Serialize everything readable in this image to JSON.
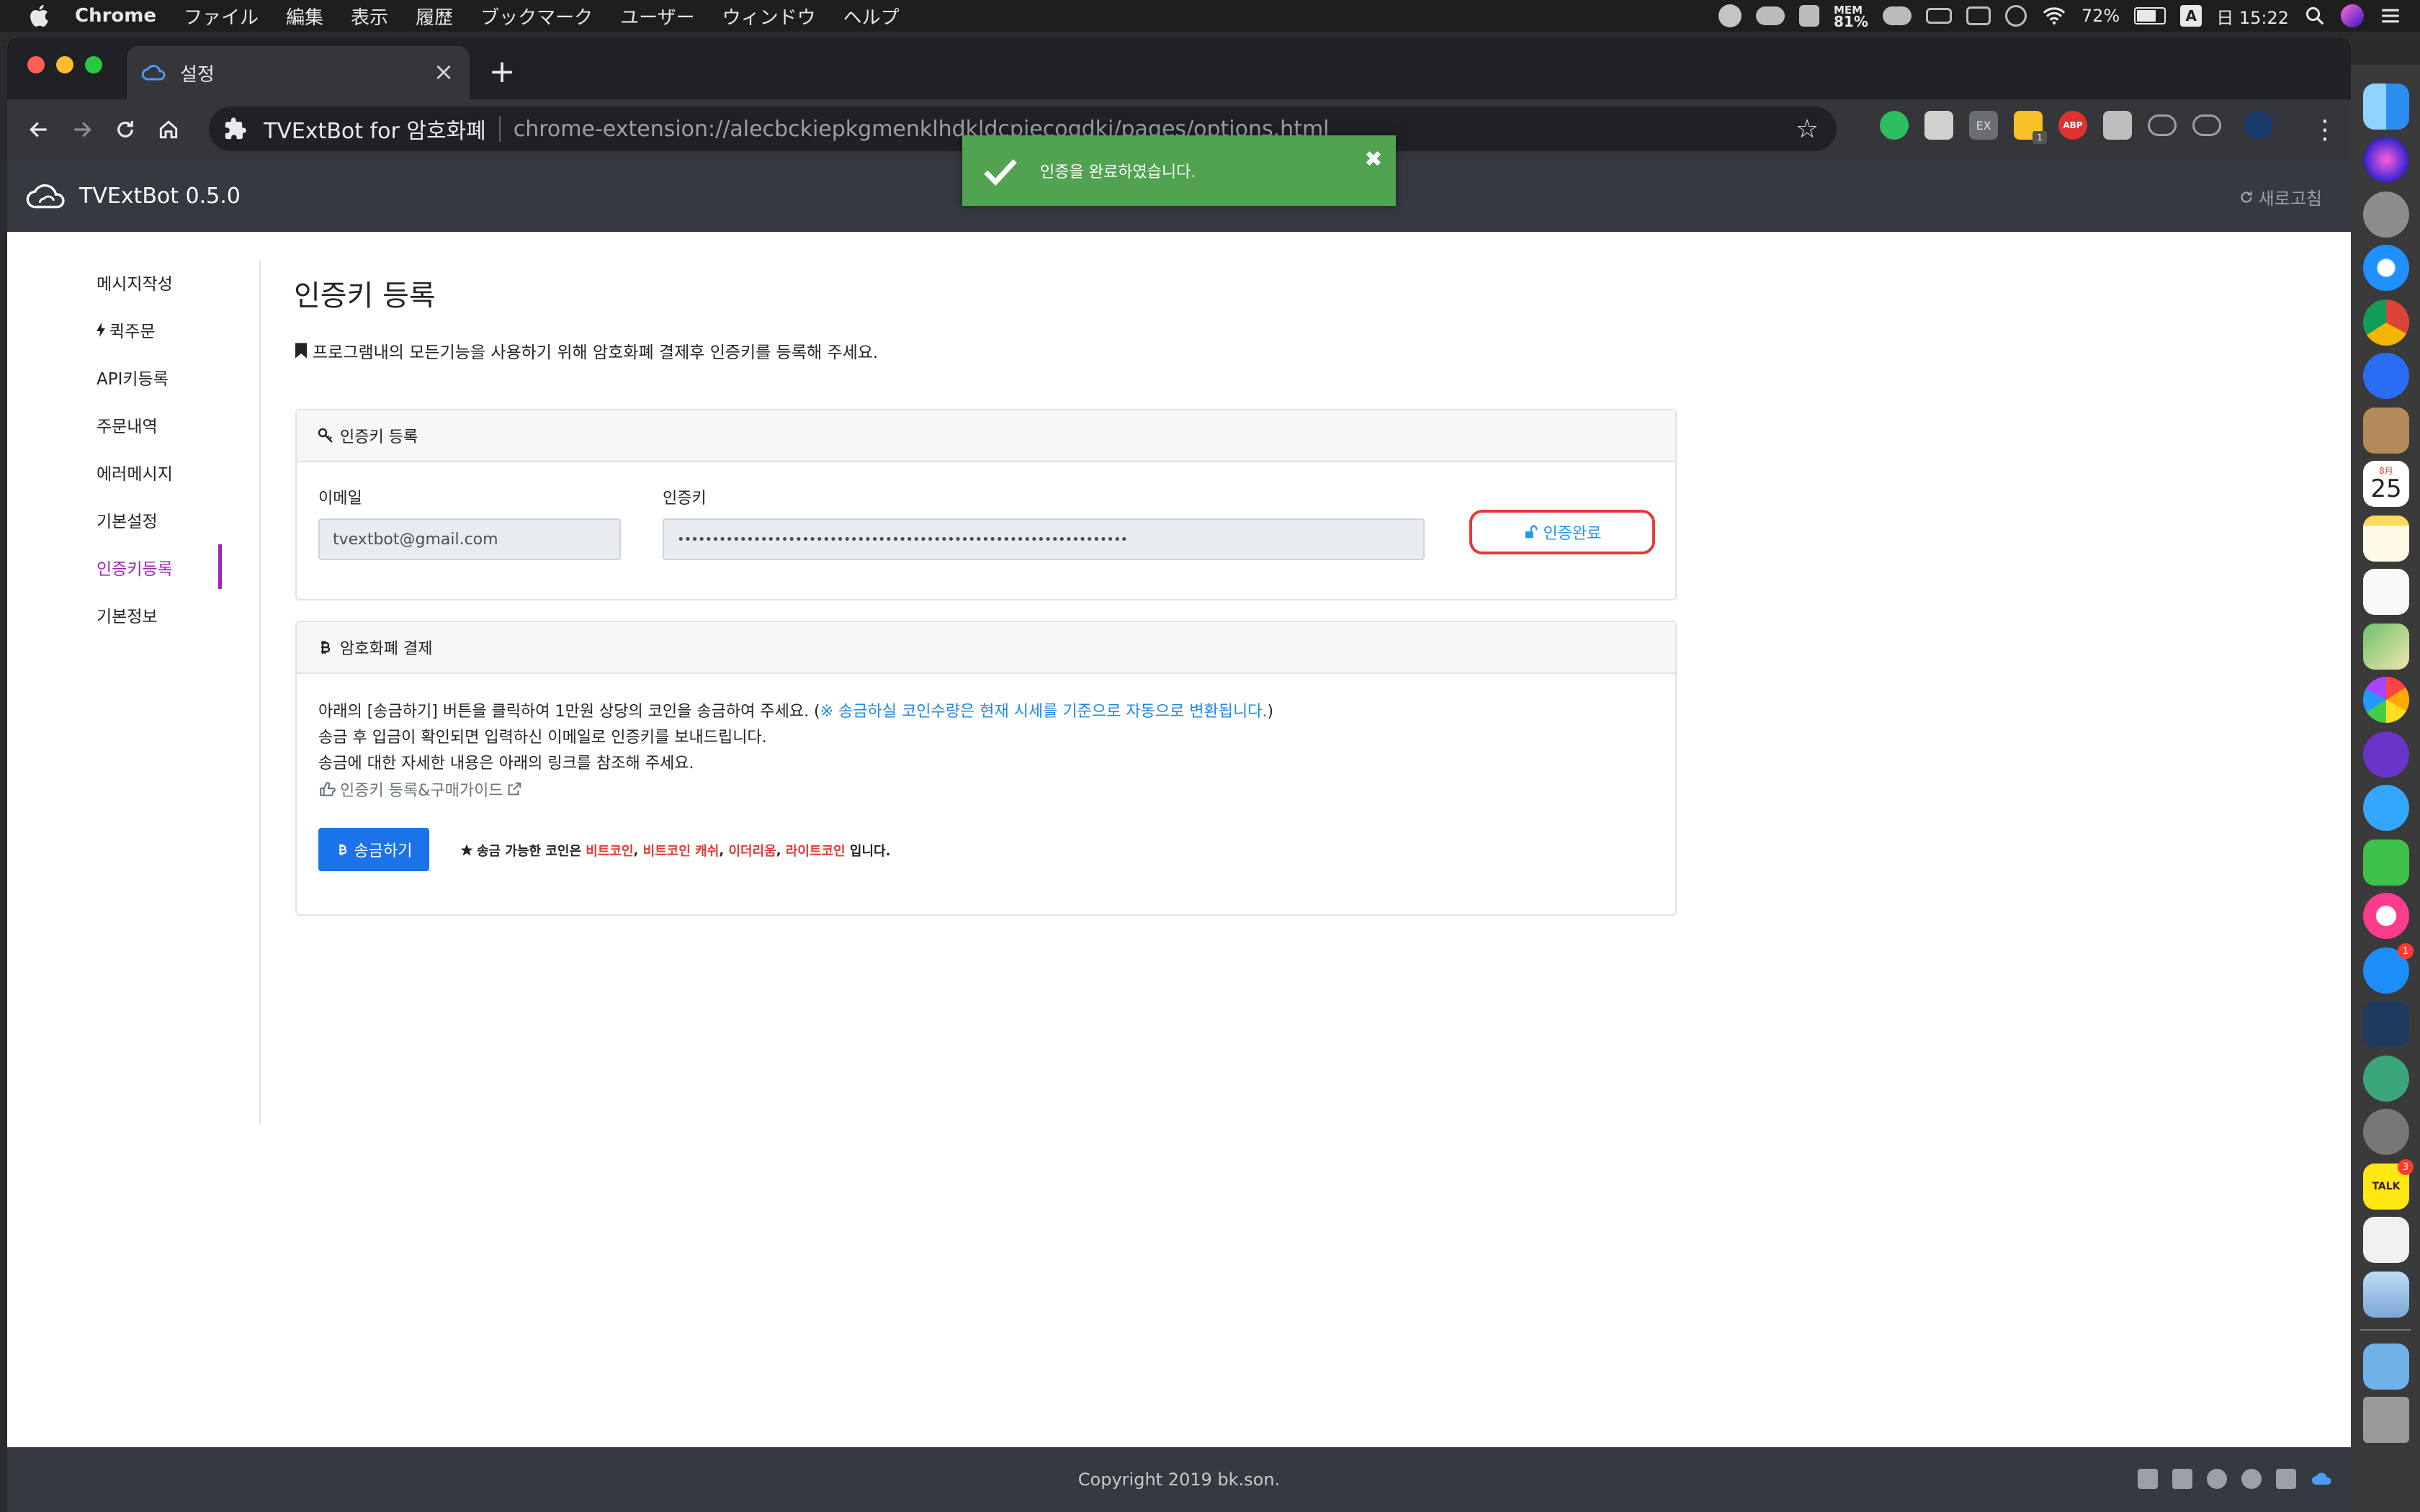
{
  "menubar": {
    "app_name": "Chrome",
    "menus": [
      "ファイル",
      "編集",
      "表示",
      "履歴",
      "ブックマーク",
      "ユーザー",
      "ウィンドウ",
      "ヘルプ"
    ],
    "mem_label": "MEM",
    "mem_value": "81%",
    "battery": "72%",
    "input_source": "A",
    "clock": "日 15:22"
  },
  "browser": {
    "tab_title": "설정",
    "site_name": "TVExtBot for 암호화폐",
    "url": "chrome-extension://alecbckiepkgmenklhdkldcpjecogdkj/pages/options.html",
    "ext_badge": "1"
  },
  "dock": {
    "calendar_day": "25",
    "calendar_month": "8月",
    "kakao_label": "TALK",
    "kakao_badge": "3",
    "appstore_badge": "1"
  },
  "app": {
    "brand": "TVExtBot 0.5.0",
    "refresh_label": "새로고침"
  },
  "toast": {
    "message": "인증을 완료하였습니다."
  },
  "sidebar": {
    "items": [
      "메시지작성",
      "퀵주문",
      "API키등록",
      "주문내역",
      "에러메시지",
      "기본설정",
      "인증키등록",
      "기본정보"
    ],
    "active_index": 6
  },
  "main": {
    "title": "인증키 등록",
    "notice": "프로그램내의 모든기능을 사용하기 위해 암호화폐 결제후 인증키를 등록해 주세요."
  },
  "auth_card": {
    "header": "인증키 등록",
    "email_label": "이메일",
    "email_value": "tvextbot@gmail.com",
    "key_label": "인증키",
    "key_value": "•••••••••••••••••••••••••••••••••••••••••••••••••••••••••••••••••",
    "button_label": "인증완료"
  },
  "pay_card": {
    "header": "암호화폐 결제",
    "line1_a": "아래의 [송금하기] 버튼을 클릭하여 1만원 상당의 코인을 송금하여 주세요. (",
    "line1_b": "※ 송금하실 코인수량은 현재 시세를 기준으로 자동으로 변환됩니다.",
    "line1_c": ")",
    "line2": "송금 후 입금이 확인되면 입력하신 이메일로 인증키를 보내드립니다.",
    "line3": "송금에 대한 자세한 내용은 아래의 링크를 참조해 주세요.",
    "guide_link": "인증키 등록&구매가이드",
    "send_button": "송금하기",
    "coins_prefix": "송금 가능한 코인은",
    "coins_list": [
      {
        "name": "비트코인",
        "suffix": ","
      },
      {
        "name": "비트코인 캐쉬",
        "suffix": ","
      },
      {
        "name": "이더리움",
        "suffix": ","
      },
      {
        "name": "라이트코인",
        "suffix": ""
      }
    ],
    "coins_suffix": "입니다."
  },
  "footer": {
    "copyright": "Copyright 2019 bk.son."
  },
  "colors": {
    "accent": "#9c27b0",
    "toast": "#51a351",
    "navbar": "#343a40",
    "primary_button": "#1a73e8",
    "highlight_ring": "#e53935"
  }
}
